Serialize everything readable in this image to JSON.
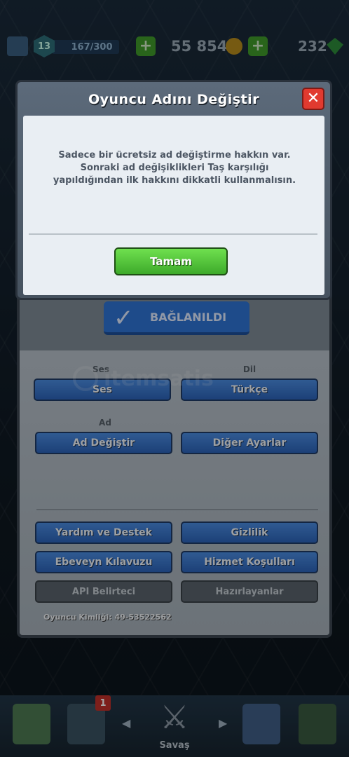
{
  "topbar": {
    "level": "13",
    "xp": "167/300",
    "gold": "55 854",
    "gems": "232",
    "plus_label": "+"
  },
  "modal": {
    "title": "Oyuncu Adını Değiştir",
    "close_label": "✕",
    "message": "Sadece bir ücretsiz ad değiştirme hakkın var. Sonraki ad değişiklikleri Taş karşılığı yapıldığından ilk hakkını dikkatli kullanmalısın.",
    "ok_label": "Tamam"
  },
  "settings": {
    "connected_label": "BAĞLANILDI",
    "sound_section": "Ses",
    "sound_button": "Ses",
    "language_section": "Dil",
    "language_button": "Türkçe",
    "name_section": "Ad",
    "change_name_button": "Ad Değiştir",
    "other_settings_button": "Diğer Ayarlar",
    "help_button": "Yardım ve Destek",
    "privacy_button": "Gizlilik",
    "parent_guide_button": "Ebeveyn Kılavuzu",
    "terms_button": "Hizmet Koşulları",
    "api_button": "API Belirteci",
    "credits_button": "Hazırlayanlar",
    "player_id": "Oyuncu Kimliği: 49-53522562"
  },
  "bottom_nav": {
    "cards_badge": "1",
    "battle_label": "Savaş"
  },
  "watermark": "itemsatis",
  "colors": {
    "ok_green": "#4cc236",
    "close_red": "#e13a2f",
    "button_blue": "#3a78cf"
  }
}
